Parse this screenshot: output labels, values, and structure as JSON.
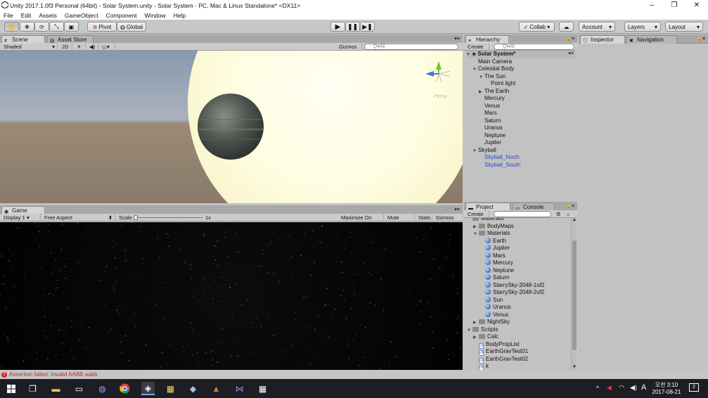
{
  "window": {
    "title": "Unity 2017.1.0f3 Personal (64bit) - Solar System.unity - Solar System - PC, Mac & Linux Standalone* <DX11>",
    "controls": [
      "–",
      "❐",
      "✕"
    ]
  },
  "menu": [
    "File",
    "Edit",
    "Assets",
    "GameObject",
    "Component",
    "Window",
    "Help"
  ],
  "toolbar": {
    "pivot": "Pivot",
    "global": "Global",
    "collab": "Collab ▾",
    "account": "Account",
    "layers": "Layers",
    "layout": "Layout"
  },
  "scene": {
    "tabs": [
      "Scene",
      "Asset Store"
    ],
    "shading": "Shaded",
    "mode_2d": "2D",
    "gizmos": "Gizmos",
    "search_placeholder": "Q▾All",
    "persp_label": "Persp"
  },
  "game": {
    "tab": "Game",
    "display": "Display 1",
    "aspect": "Free Aspect",
    "scale_label": "Scale",
    "scale_value": "1x",
    "maximize": "Maximize On Play",
    "mute": "Mute Audio",
    "stats": "Stats",
    "gizmos": "Gizmos"
  },
  "hierarchy": {
    "tab": "Hierarchy",
    "create": "Create",
    "search_placeholder": "Q▾All",
    "scene_name": "Solar System*",
    "items": [
      {
        "label": "Main Camera",
        "depth": 1,
        "arrow": ""
      },
      {
        "label": "Celestial Body",
        "depth": 1,
        "arrow": "▼"
      },
      {
        "label": "The Sun",
        "depth": 2,
        "arrow": "▼"
      },
      {
        "label": "Point light",
        "depth": 3,
        "arrow": ""
      },
      {
        "label": "The Earth",
        "depth": 2,
        "arrow": "▶"
      },
      {
        "label": "Mercury",
        "depth": 2,
        "arrow": ""
      },
      {
        "label": "Venus",
        "depth": 2,
        "arrow": ""
      },
      {
        "label": "Mars",
        "depth": 2,
        "arrow": ""
      },
      {
        "label": "Saturn",
        "depth": 2,
        "arrow": ""
      },
      {
        "label": "Uranus",
        "depth": 2,
        "arrow": ""
      },
      {
        "label": "Neptune",
        "depth": 2,
        "arrow": ""
      },
      {
        "label": "Jupiter",
        "depth": 2,
        "arrow": ""
      },
      {
        "label": "Skyball",
        "depth": 1,
        "arrow": "▼"
      },
      {
        "label": "Skyball_North",
        "depth": 2,
        "arrow": "",
        "prefab": true
      },
      {
        "label": "Skyball_South",
        "depth": 2,
        "arrow": "",
        "prefab": true
      }
    ]
  },
  "project": {
    "tabs": [
      "Project",
      "Console"
    ],
    "create": "Create",
    "items": [
      {
        "label": "Materials",
        "depth": 0,
        "arrow": "",
        "type": "folder"
      },
      {
        "label": "BodyMaps",
        "depth": 1,
        "arrow": "▶",
        "type": "folder"
      },
      {
        "label": "Materials",
        "depth": 1,
        "arrow": "▼",
        "type": "folder"
      },
      {
        "label": "Earth",
        "depth": 2,
        "arrow": "",
        "type": "material"
      },
      {
        "label": "Jupiter",
        "depth": 2,
        "arrow": "",
        "type": "material"
      },
      {
        "label": "Mars",
        "depth": 2,
        "arrow": "",
        "type": "material"
      },
      {
        "label": "Mercury",
        "depth": 2,
        "arrow": "",
        "type": "material"
      },
      {
        "label": "Neptune",
        "depth": 2,
        "arrow": "",
        "type": "material"
      },
      {
        "label": "Saturn",
        "depth": 2,
        "arrow": "",
        "type": "material"
      },
      {
        "label": "StarrySky-2048-1of2",
        "depth": 2,
        "arrow": "",
        "type": "material"
      },
      {
        "label": "StarrySky-2048-2of2",
        "depth": 2,
        "arrow": "",
        "type": "material"
      },
      {
        "label": "Sun",
        "depth": 2,
        "arrow": "",
        "type": "material"
      },
      {
        "label": "Uranus",
        "depth": 2,
        "arrow": "",
        "type": "material"
      },
      {
        "label": "Venus",
        "depth": 2,
        "arrow": "",
        "type": "material"
      },
      {
        "label": "NightSky",
        "depth": 1,
        "arrow": "▶",
        "type": "folder"
      },
      {
        "label": "Scripts",
        "depth": 0,
        "arrow": "▼",
        "type": "folder"
      },
      {
        "label": "Calc",
        "depth": 1,
        "arrow": "▶",
        "type": "folder"
      },
      {
        "label": "BodyPropList",
        "depth": 1,
        "arrow": "",
        "type": "script"
      },
      {
        "label": "EarthGravTest01",
        "depth": 1,
        "arrow": "",
        "type": "script"
      },
      {
        "label": "EarthGravTest02",
        "depth": 1,
        "arrow": "",
        "type": "script"
      },
      {
        "label": "k",
        "depth": 1,
        "arrow": "",
        "type": "script"
      }
    ]
  },
  "inspector": {
    "tabs": [
      "Inspector",
      "Navigation"
    ]
  },
  "status": {
    "message": "Assertion failed: Invalid AABB aabb"
  },
  "taskbar": {
    "ime": "A",
    "time": "오전 3:10",
    "date": "2017-08-21",
    "notif_count": "2"
  }
}
